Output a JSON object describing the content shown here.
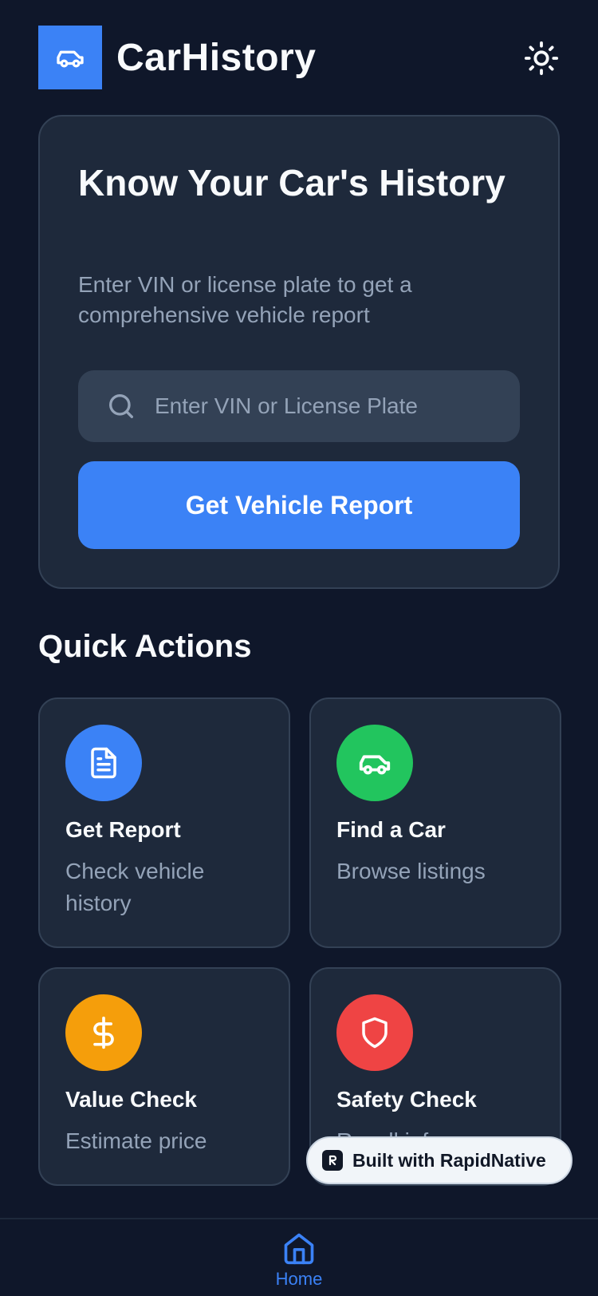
{
  "header": {
    "app_title": "CarHistory",
    "logo_icon": "car-icon",
    "theme_icon": "sun-icon"
  },
  "hero": {
    "title": "Know Your Car's History",
    "subtitle": "Enter VIN or license plate to get a comprehensive vehicle report",
    "search": {
      "placeholder": "Enter VIN or License Plate",
      "value": "",
      "icon": "search-icon"
    },
    "button_label": "Get Vehicle Report"
  },
  "quick_actions": {
    "title": "Quick Actions",
    "items": [
      {
        "title": "Get Report",
        "subtitle": "Check vehicle history",
        "icon": "document-icon",
        "color": "#3b82f6"
      },
      {
        "title": "Find a Car",
        "subtitle": "Browse listings",
        "icon": "car-icon",
        "color": "#22c55e"
      },
      {
        "title": "Value Check",
        "subtitle": "Estimate price",
        "icon": "dollar-icon",
        "color": "#f59e0b"
      },
      {
        "title": "Safety Check",
        "subtitle": "Recall info",
        "icon": "shield-icon",
        "color": "#ef4444"
      }
    ]
  },
  "badge": {
    "label": "Built with RapidNative"
  },
  "bottom_nav": {
    "items": [
      {
        "label": "Home",
        "icon": "home-icon",
        "active": true
      }
    ]
  },
  "colors": {
    "background": "#0f172a",
    "card": "#1e293b",
    "accent": "#3b82f6"
  }
}
